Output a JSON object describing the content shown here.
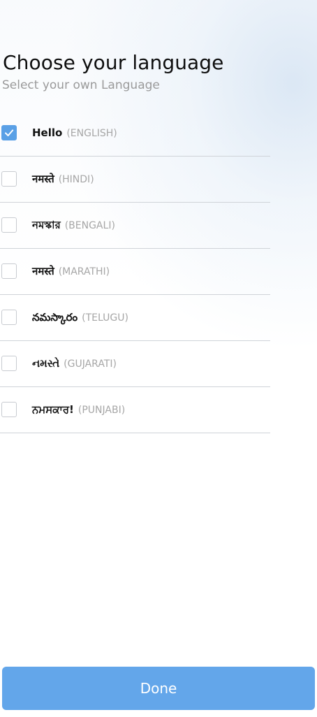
{
  "header": {
    "title": "Choose your language",
    "subtitle": "Select your own Language"
  },
  "languages": [
    {
      "greeting": "Hello",
      "name": "(ENGLISH)",
      "checked": true
    },
    {
      "greeting": "नमस्ते",
      "name": "(HINDI)",
      "checked": false
    },
    {
      "greeting": "নমস্কার",
      "name": "(BENGALI)",
      "checked": false
    },
    {
      "greeting": "नमस्ते",
      "name": "(MARATHI)",
      "checked": false
    },
    {
      "greeting": "నమస్కారం",
      "name": "(TELUGU)",
      "checked": false
    },
    {
      "greeting": "નમસ્તે",
      "name": "(GUJARATI)",
      "checked": false
    },
    {
      "greeting": "ਨਮਸਕਾਰ!",
      "name": "(PUNJABI)",
      "checked": false
    }
  ],
  "footer": {
    "done_label": "Done"
  },
  "colors": {
    "accent": "#5aa0e6",
    "button": "#63a6ea",
    "divider": "#cfd3d8"
  },
  "icons": {
    "checkbox_checked": "check-icon"
  }
}
